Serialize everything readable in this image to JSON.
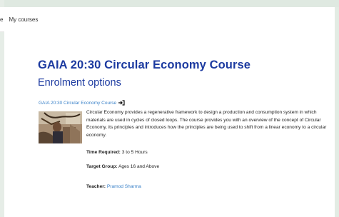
{
  "nav": {
    "partial_item": "e",
    "my_courses": "My courses"
  },
  "course": {
    "title": "GAIA 20:30 Circular Economy Course",
    "subtitle": "Enrolment options",
    "link_text": "GAIA 20:30 Circular Economy Course",
    "summary": "Circular Economy provides a regenerative framework to design a production and consumption system in which materials are used in cycles of closed loops. The course provides you with an overview of the concept of Circular Economy, its principles and introduces how the principles are being used to shift from a linear economy to a circular economy.",
    "time_required_label": "Time Required:",
    "time_required_value": "3 to 5 Hours",
    "target_group_label": "Target Group:",
    "target_group_value": "Ages 16 and Above",
    "teacher_label": "Teacher:",
    "teacher_value": "Pramod Sharma"
  },
  "colors": {
    "title": "#1c3aa0",
    "link": "#3b82c9",
    "background": "#dfe9e1"
  }
}
